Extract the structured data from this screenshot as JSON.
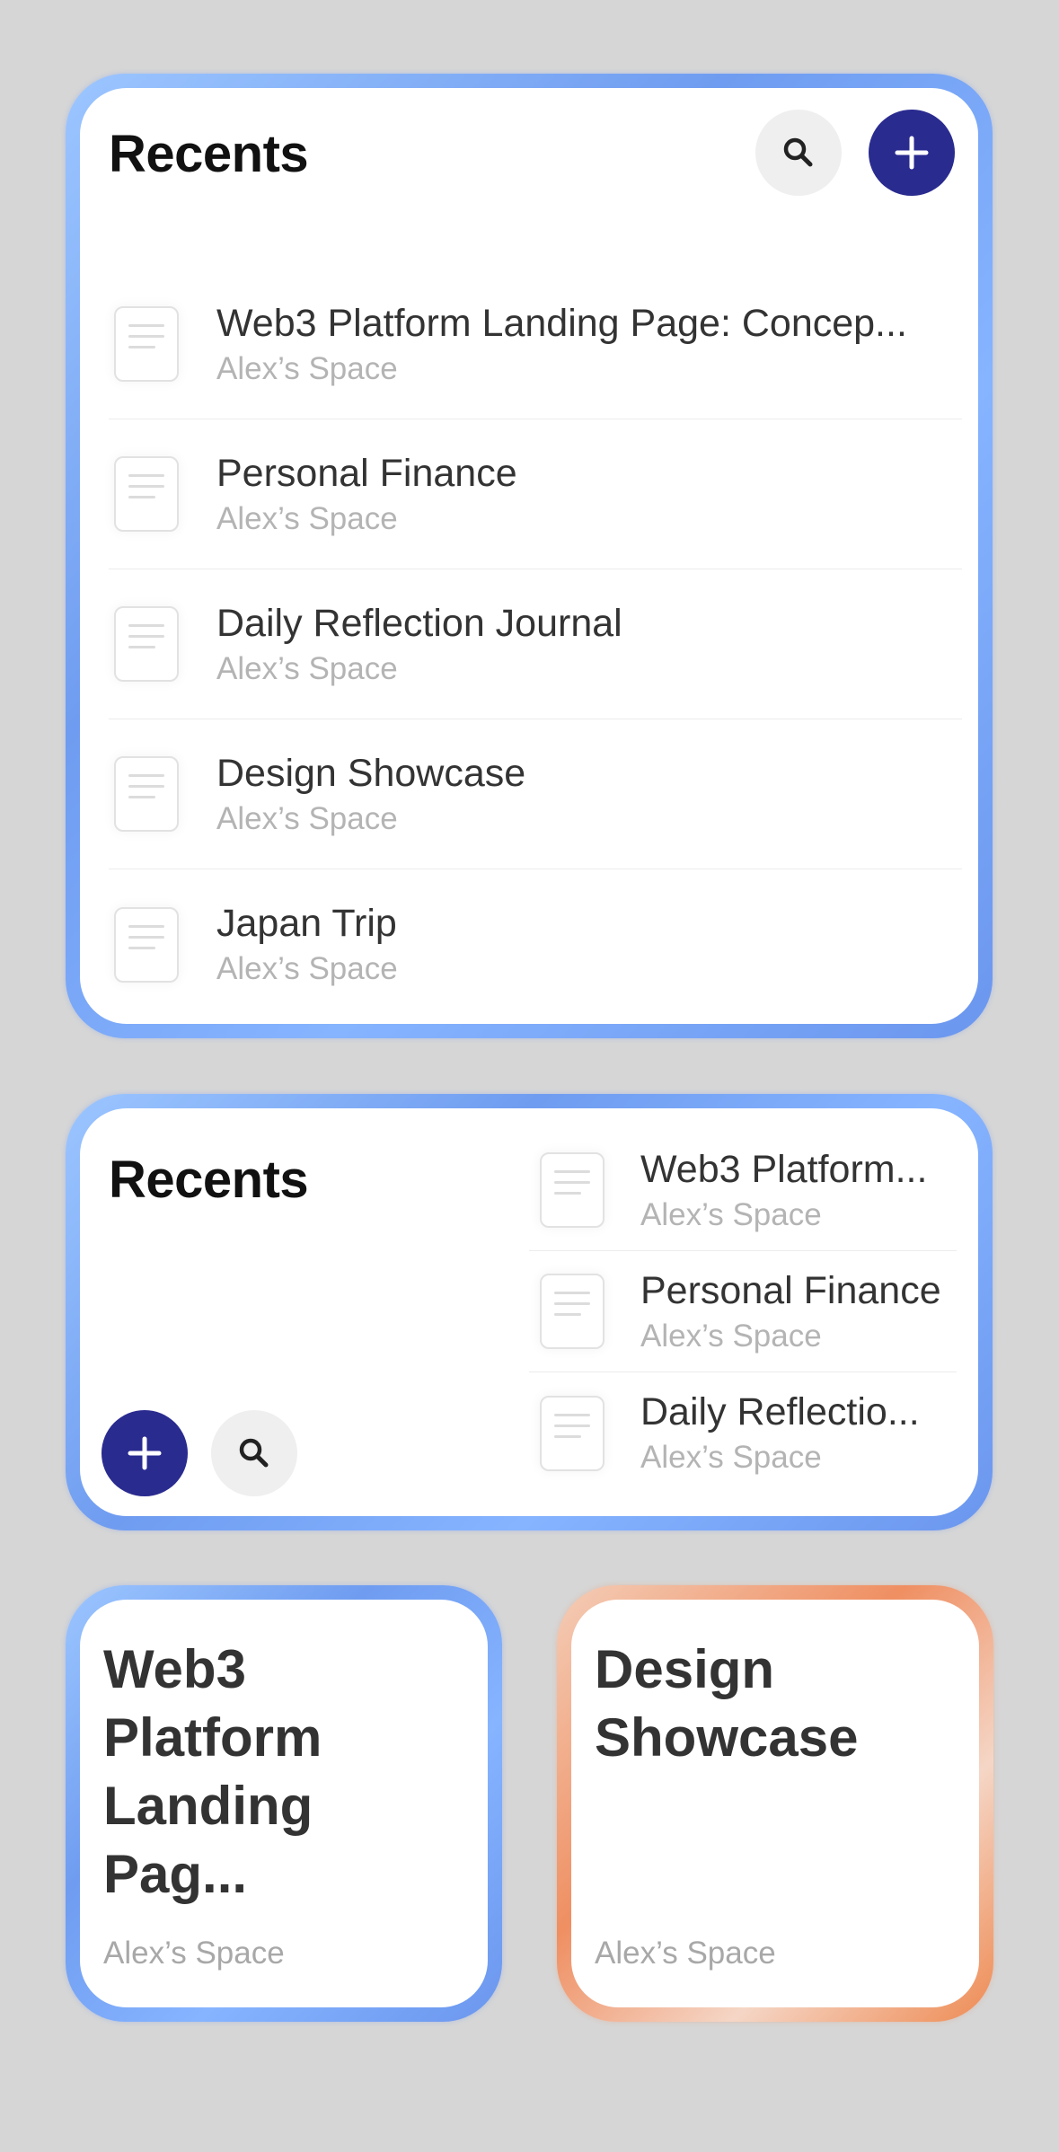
{
  "colors": {
    "background": "#d6d6d6",
    "accent_blue_border": "#7fa8f5",
    "accent_orange_border": "#ef8f62",
    "add_button": "#2a2b8f",
    "search_button": "#efefef"
  },
  "large_widget": {
    "title": "Recents",
    "search_icon": "search-icon",
    "add_icon": "plus-icon",
    "items": [
      {
        "title": "Web3 Platform Landing Page: Concep...",
        "subtitle": "Alex’s Space"
      },
      {
        "title": "Personal Finance",
        "subtitle": "Alex’s Space"
      },
      {
        "title": "Daily Reflection Journal",
        "subtitle": "Alex’s Space"
      },
      {
        "title": "Design Showcase",
        "subtitle": "Alex’s Space"
      },
      {
        "title": "Japan Trip",
        "subtitle": "Alex’s Space"
      }
    ]
  },
  "medium_widget": {
    "title": "Recents",
    "items": [
      {
        "title": "Web3 Platform...",
        "subtitle": "Alex’s Space"
      },
      {
        "title": "Personal Finance",
        "subtitle": "Alex’s Space"
      },
      {
        "title": "Daily Reflectio...",
        "subtitle": "Alex’s Space"
      }
    ]
  },
  "small_widgets": [
    {
      "title": "Web3 Platform Landing Pag...",
      "subtitle": "Alex’s Space",
      "theme": "blue"
    },
    {
      "title": "Design Showcase",
      "subtitle": "Alex’s Space",
      "theme": "orange"
    }
  ]
}
